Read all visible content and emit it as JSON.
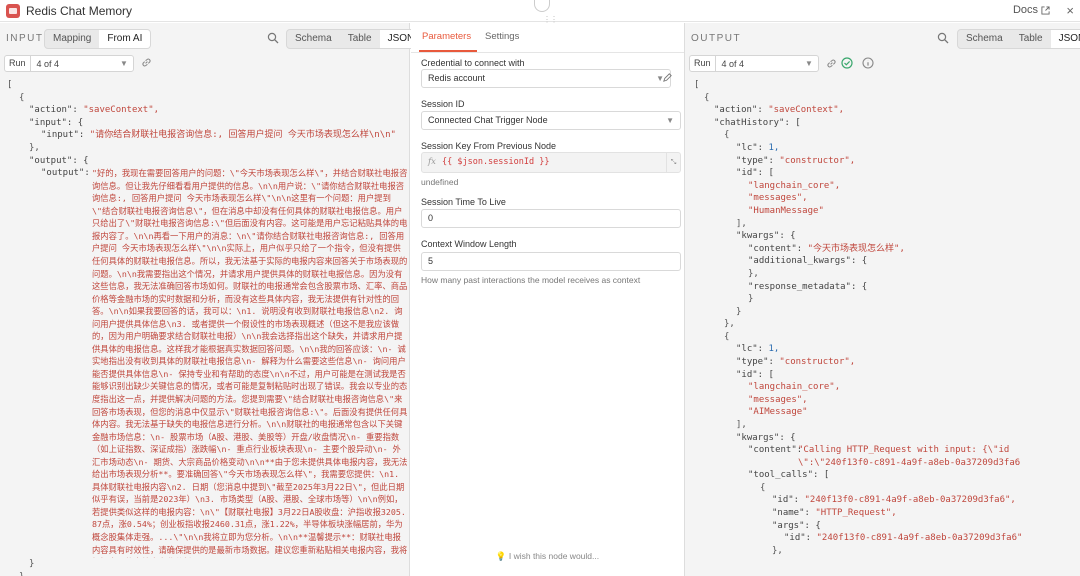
{
  "app": {
    "title": "Redis Chat Memory",
    "docs_label": "Docs",
    "close_glyph": "×",
    "brand_color": "#d9534f",
    "accent_color": "#e8593c"
  },
  "input_panel": {
    "label": "INPUT",
    "mode_tabs": [
      "Mapping",
      "From AI"
    ],
    "view_tabs": [
      "Schema",
      "Table",
      "JSON"
    ],
    "run_label": "Run",
    "run_value": "4 of 4",
    "json": {
      "action_key": "\"action\":",
      "action_val": "\"saveContext\",",
      "input_key": "\"input\": {",
      "inner_input_key": "\"input\":",
      "inner_input_val": "\"请你结合财联社电报咨询信息:, 回答用户提问 今天市场表现怎么样\\n\\n\"",
      "output_key": "\"output\": {",
      "inner_output_key": "\"output\":",
      "inner_output_val": "\"好的，我现在需要回答用户的问题：\\\"今天市场表现怎么样\\\"，并结合财联社电报咨询信息。但让我先仔细看看用户提供的信息。\\n\\n用户说：\\\"请你结合财联社电报咨询信息:, 回答用户提问 今天市场表现怎么样\\\"\\n\\n这里有一个问题：用户提到\\\"结合财联社电报咨询信息\\\"，但在消息中却没有任何具体的财联社电报信息。用户只给出了\\\"财联社电报咨询信息:\\\"但后面没有内容。这可能是用户忘记粘贴具体的电报内容了。\\n\\n再看一下用户的消息：\\n\\\"请你结合财联社电报咨询信息:, 回答用户提问 今天市场表现怎么样\\\"\\n\\n实际上，用户似乎只给了一个指令，但没有提供任何具体的财联社电报信息。所以，我无法基于实际的电报内容来回答关于市场表现的问题。\\n\\n我需要指出这个情况，并请求用户提供具体的财联社电报信息。因为没有这些信息，我无法准确回答市场如何。财联社的电报通常会包含股票市场、汇率、商品价格等金融市场的实时数据和分析，而没有这些具体内容，我无法提供有针对性的回答。\\n\\n如果我要回答的话，我可以：\\n1. 说明没有收到财联社电报信息\\n2. 询问用户提供具体信息\\n3. 或者提供一个假设性的市场表现概述（但这不是我应该做的，因为用户明确要求结合财联社电报）\\n\\n我会选择指出这个缺失，并请求用户提供具体的电报信息。这样我才能根据真实数据回答问题。\\n\\n我的回答应该：\\n- 诚实地指出没有收到具体的财联社电报信息\\n- 解释为什么需要这些信息\\n- 询问用户能否提供具体信息\\n- 保持专业和有帮助的态度\\n\\n不过，用户可能是在测试我是否能够识别出缺少关键信息的情况，或者可能是复制粘贴时出现了错误。我会以专业的态度指出这一点，并提供解决问题的方法。您提到需要\\\"结合财联社电报咨询信息\\\"来回答市场表现，但您的消息中仅显示\\\"财联社电报咨询信息:\\\"。后面没有提供任何具体内容。我无法基于缺失的电报信息进行分析。\\n\\n财联社的电报通常包含以下关键金融市场信息：\\n- 股票市场（A股、港股、美股等）开盘/收盘情况\\n- 重要指数（如上证指数、深证成指）涨跌幅\\n- 重点行业板块表现\\n- 主要个股异动\\n- 外汇市场动态\\n- 期货、大宗商品价格变动\\n\\n**由于您未提供具体电报内容，我无法给出市场表现分析**。要准确回答\\\"今天市场表现怎么样\\\"，我需要您提供：\\n1. 具体财联社电报内容\\n2. 日期（您消息中提到\\\"截至2025年3月22日\\\"，但此日期似乎有误，当前是2023年）\\n3. 市场类型（A股、港股、全球市场等）\\n\\n例如，若提供类似这样的电报内容：\\n\\\"【财联社电报】3月22日A股收盘：沪指收报3205.87点，涨0.54%；创业板指收报2460.31点，涨1.22%，半导体板块涨幅居前，华为概念股集体走强。...\\\"\\n\\n我将立即为您分析。\\n\\n**温馨提示**：财联社电报内容具有时效性，请确保提供的是最新市场数据。建议您重新粘贴相关电报内容，我将根据实际信息给出专业分析。\""
    }
  },
  "params_panel": {
    "tabs": [
      "Parameters",
      "Settings"
    ],
    "credential_label": "Credential to connect with",
    "credential_value": "Redis account",
    "session_id_label": "Session ID",
    "session_id_value": "Connected Chat Trigger Node",
    "session_key_label": "Session Key From Previous Node",
    "session_key_fx": "fx",
    "session_key_expr": "{{ $json.sessionId }}",
    "session_key_result": "undefined",
    "ttl_label": "Session Time To Live",
    "ttl_value": "0",
    "window_label": "Context Window Length",
    "window_value": "5",
    "window_hint": "How many past interactions the model receives as context",
    "wish_text": "I wish this node would..."
  },
  "output_panel": {
    "label": "OUTPUT",
    "view_tabs": [
      "Schema",
      "Table",
      "JSON"
    ],
    "run_label": "Run",
    "run_value": "4 of 4",
    "json": {
      "action_key": "\"action\":",
      "action_val": "\"saveContext\",",
      "history_key": "\"chatHistory\": [",
      "lc_key": "\"lc\":",
      "lc_val": "1,",
      "type_key": "\"type\":",
      "type_val": "\"constructor\",",
      "id_key": "\"id\": [",
      "id_0": "\"langchain_core\",",
      "id_1": "\"messages\",",
      "id_2": "\"HumanMessage\"",
      "id_2b": "\"AIMessage\"",
      "kwargs_key": "\"kwargs\": {",
      "content_key": "\"content\":",
      "content_val": "\"今天市场表现怎么样\",",
      "add_kwargs_key": "\"additional_kwargs\": {",
      "resp_meta_key": "\"response_metadata\": {",
      "ai_content_val": "\"Calling HTTP_Request with input: {\\\"id\\\":\\\"240f13f0-c891-4a9f-a8eb-0a37209d3fa6\\\"}\",",
      "tool_calls_key": "\"tool_calls\": [",
      "tc_id_key": "\"id\":",
      "tc_id_val": "\"240f13f0-c891-4a9f-a8eb-0a37209d3fa6\",",
      "tc_name_key": "\"name\":",
      "tc_name_val": "\"HTTP_Request\",",
      "tc_args_key": "\"args\": {",
      "tc_arg_id_val": "\"240f13f0-c891-4a9f-a8eb-0a37209d3fa6\""
    }
  },
  "icons": {
    "search": "search-icon",
    "pin": "pin-icon",
    "edit": "pencil-icon",
    "refresh": "refresh-icon",
    "success": "check-circle-icon",
    "info": "info-icon",
    "bulb": "lightbulb-icon"
  }
}
